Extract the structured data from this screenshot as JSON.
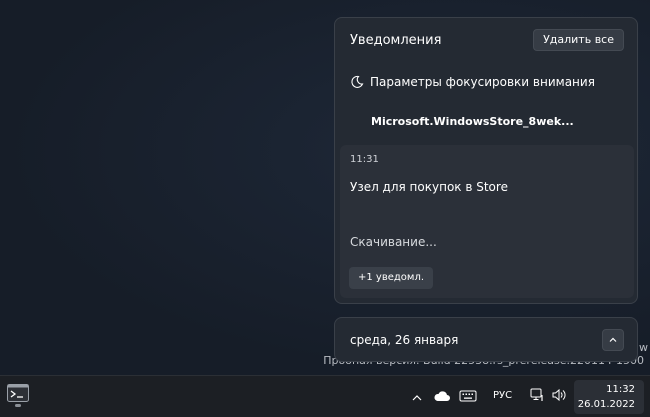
{
  "desktop": {
    "watermark": "Пробная версия. Build 22538.rs_prerelease.220114-1500",
    "watermark_line_end": "w"
  },
  "notifications": {
    "title": "Уведомления",
    "clear_all_label": "Удалить все",
    "focus_label": "Параметры фокусировки внимания",
    "app_name": "Microsoft.WindowsStore_8wek...",
    "toast": {
      "time": "11:31",
      "title": "Узел для покупок в Store",
      "body": "Скачивание...",
      "more_label": "+1 уведомл."
    }
  },
  "calendar": {
    "date_label": "среда, 26 января"
  },
  "taskbar": {
    "language": "РУС",
    "clock_time": "11:32",
    "clock_date": "26.01.2022"
  },
  "icons": {
    "moon": "moon-icon",
    "chevron_up": "chevron-up-icon",
    "terminal": "terminal-icon",
    "cloud": "onedrive-cloud-icon",
    "keyboard": "touch-keyboard-icon",
    "network": "network-icon",
    "volume": "volume-icon"
  },
  "colors": {
    "panel_bg": "#242a33",
    "toast_bg": "#2b3039",
    "taskbar_bg": "#1c1f24"
  }
}
